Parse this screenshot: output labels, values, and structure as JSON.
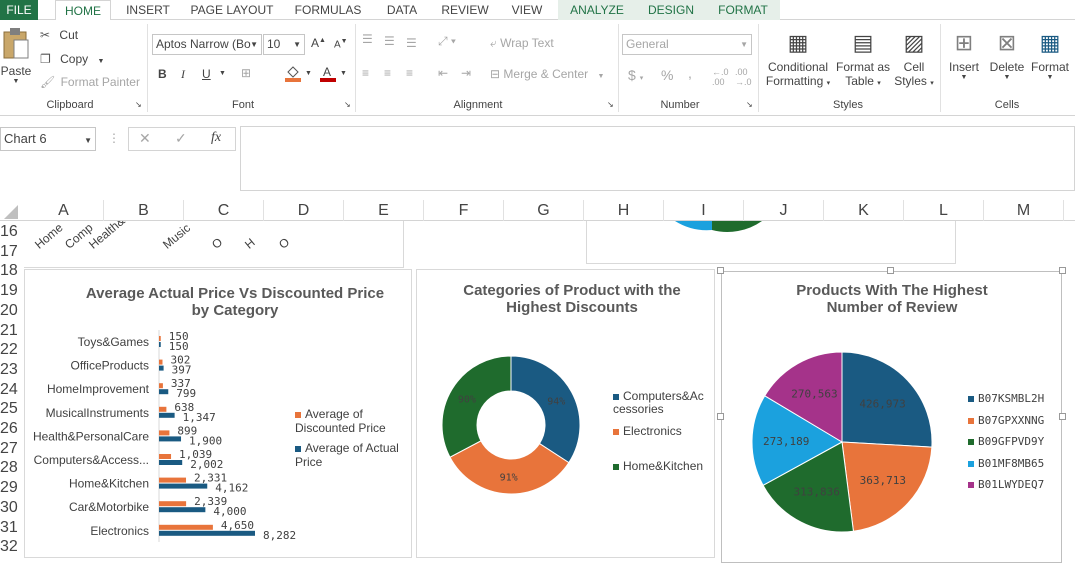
{
  "tabs": [
    "FILE",
    "HOME",
    "INSERT",
    "PAGE LAYOUT",
    "FORMULAS",
    "DATA",
    "REVIEW",
    "VIEW",
    "ANALYZE",
    "DESIGN",
    "FORMAT"
  ],
  "clipboard": {
    "paste": "Paste",
    "cut": "Cut",
    "copy": "Copy",
    "format_painter": "Format Painter",
    "label": "Clipboard"
  },
  "font": {
    "name": "Aptos Narrow (Bo",
    "size": "10",
    "label": "Font",
    "bold": "B",
    "italic": "I",
    "underline": "U"
  },
  "alignment": {
    "wrap": "Wrap Text",
    "merge": "Merge & Center",
    "label": "Alignment"
  },
  "number": {
    "format": "General",
    "label": "Number",
    "currency": "$",
    "percent": "%",
    "comma": ","
  },
  "styles": {
    "conditional": "Conditional",
    "formatting": "Formatting",
    "format_as": "Format as",
    "table": "Table",
    "cell": "Cell",
    "cell_styles": "Styles",
    "label": "Styles"
  },
  "cells": {
    "insert": "Insert",
    "delete": "Delete",
    "format": "Format",
    "label": "Cells"
  },
  "formula_bar": {
    "name_box": "Chart 6",
    "fx": "fx",
    "formula": ""
  },
  "columns": [
    "A",
    "B",
    "C",
    "D",
    "E",
    "F",
    "G",
    "H",
    "I",
    "J",
    "K",
    "L",
    "M"
  ],
  "rows": [
    "16",
    "17",
    "18",
    "19",
    "20",
    "21",
    "22",
    "23",
    "24",
    "25",
    "26",
    "27",
    "28",
    "29",
    "30",
    "31",
    "32"
  ],
  "top_chart_labels": [
    "Home",
    "Comp",
    "Health&",
    "Music",
    "O",
    "H",
    "O"
  ],
  "colors": {
    "blue": "#1a5a82",
    "orange": "#e8743b",
    "green": "#1f6b2d",
    "cyan": "#1ba1de",
    "purple": "#a5338a",
    "ribbon_green": "#217346"
  },
  "chart_data": [
    {
      "type": "bar",
      "title": "Average Actual Price Vs Discounted Price by Category",
      "categories": [
        "Toys&Games",
        "OfficeProducts",
        "HomeImprovement",
        "MusicalInstruments",
        "Health&PersonalCare",
        "Computers&Access...",
        "Home&Kitchen",
        "Car&Motorbike",
        "Electronics"
      ],
      "series": [
        {
          "name": "Average of Discounted Price",
          "color": "#e8743b",
          "values": [
            150,
            302,
            337,
            638,
            899,
            1039,
            2331,
            2339,
            4650
          ],
          "labels": [
            "150",
            "302",
            "337",
            "638",
            "899",
            "1,039",
            "2,331",
            "2,339",
            "4,650"
          ]
        },
        {
          "name": "Average of Actual Price",
          "color": "#1a5a82",
          "values": [
            150,
            397,
            799,
            1347,
            1900,
            2002,
            4162,
            4000,
            8282
          ],
          "labels": [
            "150",
            "397",
            "799",
            "1,347",
            "1,900",
            "2,002",
            "4,162",
            "4,000",
            "8,282"
          ]
        }
      ]
    },
    {
      "type": "pie",
      "title": "Categories of Product with the Highest Discounts",
      "slices": [
        {
          "name": "Computers&Accessories",
          "label": "94%",
          "value": 94,
          "color": "#1a5a82"
        },
        {
          "name": "Electronics",
          "label": "91%",
          "value": 91,
          "color": "#e8743b"
        },
        {
          "name": "Home&Kitchen",
          "label": "90%",
          "value": 90,
          "color": "#1f6b2d"
        }
      ],
      "legend": [
        "Computers&Ac cessories",
        "Electronics",
        "Home&Kitchen"
      ]
    },
    {
      "type": "pie",
      "title": "Products With The Highest Number of Review",
      "slices": [
        {
          "name": "B07KSMBL2H",
          "label": "426,973",
          "value": 426973,
          "color": "#1a5a82"
        },
        {
          "name": "B07GPXXNNG",
          "label": "363,713",
          "value": 363713,
          "color": "#e8743b"
        },
        {
          "name": "B09GFPVD9Y",
          "label": "313,836",
          "value": 313836,
          "color": "#1f6b2d"
        },
        {
          "name": "B01MF8MB65",
          "label": "273,189",
          "value": 273189,
          "color": "#1ba1de"
        },
        {
          "name": "B01LWYDEQ7",
          "label": "270,563",
          "value": 270563,
          "color": "#a5338a"
        }
      ]
    }
  ]
}
